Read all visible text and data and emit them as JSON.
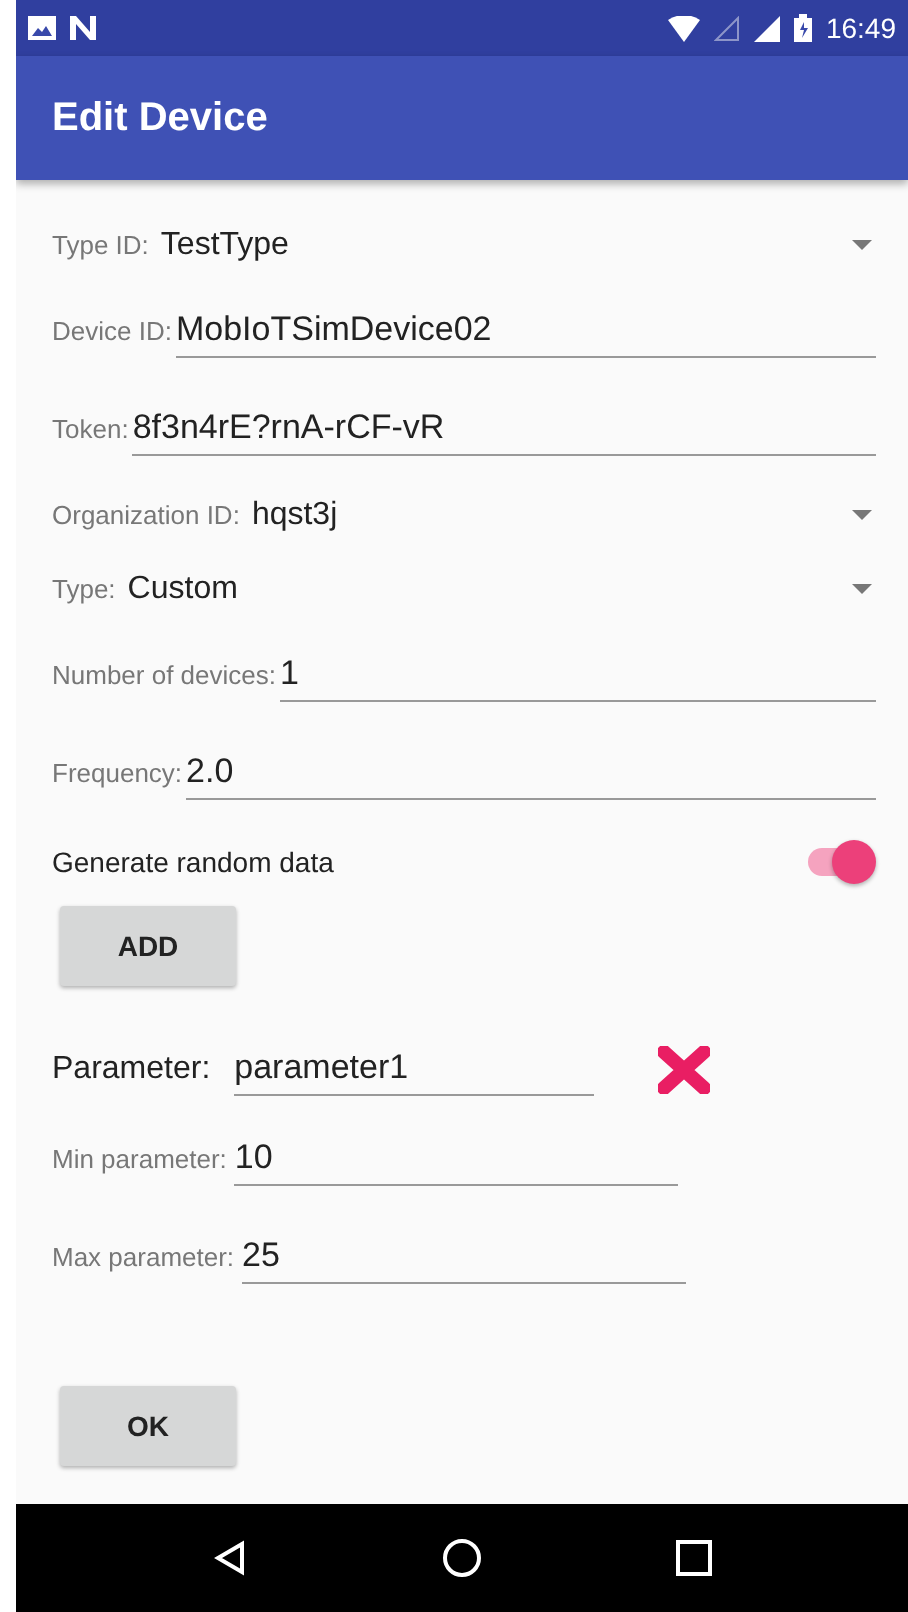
{
  "status_bar": {
    "time": "16:49"
  },
  "app_bar": {
    "title": "Edit Device"
  },
  "fields": [
    {
      "kind": "dropdown",
      "label": "Type ID:",
      "value": "TestType"
    },
    {
      "kind": "text",
      "label": "Device ID:",
      "value": "MobIoTSimDevice02"
    },
    {
      "kind": "text",
      "label": "Token:",
      "value": "8f3n4rE?rnA-rCF-vR"
    },
    {
      "kind": "dropdown",
      "label": "Organization ID:",
      "value": "hqst3j"
    },
    {
      "kind": "dropdown",
      "label": "Type:",
      "value": "Custom"
    },
    {
      "kind": "text",
      "label": "Number of devices:",
      "value": "1"
    },
    {
      "kind": "text",
      "label": "Frequency:",
      "value": "2.0"
    }
  ],
  "random_data": {
    "label": "Generate random data",
    "on": true
  },
  "add_button": "ADD",
  "parameter": {
    "label": "Parameter:",
    "value": "parameter1"
  },
  "ranges": [
    {
      "label": "Min parameter:",
      "value": "10"
    },
    {
      "label": "Max parameter:",
      "value": "25"
    }
  ],
  "ok_button": "OK"
}
